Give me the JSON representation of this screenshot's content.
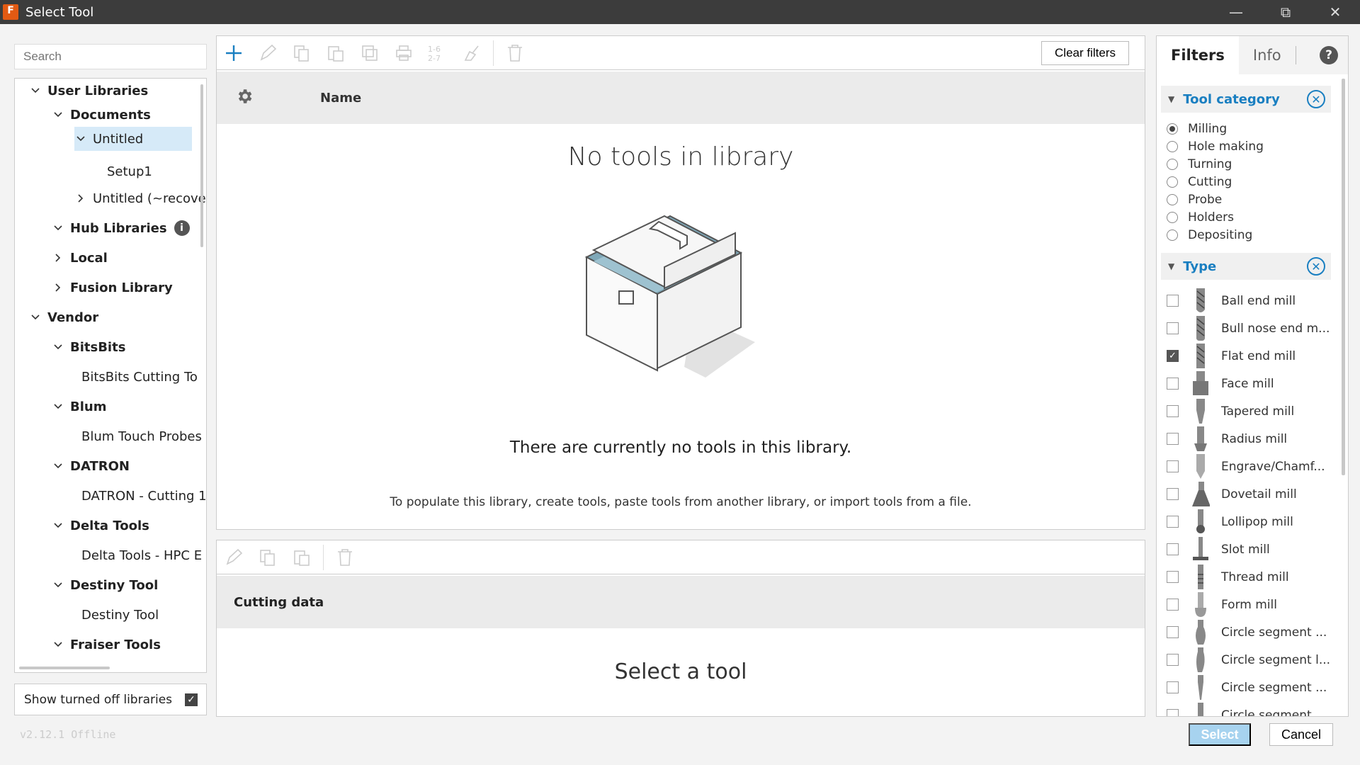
{
  "window": {
    "title": "Select Tool",
    "app_icon_letter": "F"
  },
  "search": {
    "placeholder": "Search"
  },
  "tree": [
    {
      "label": "User Libraries",
      "bold": true
    },
    {
      "label": "Documents",
      "bold": true
    },
    {
      "label": "Untitled",
      "bold": false
    },
    {
      "label": "Setup1",
      "bold": false
    },
    {
      "label": "Untitled (~recove",
      "bold": false
    },
    {
      "label": "Hub Libraries",
      "bold": true
    },
    {
      "label": "Local",
      "bold": true
    },
    {
      "label": "Fusion Library",
      "bold": true
    },
    {
      "label": "Vendor",
      "bold": true
    },
    {
      "label": "BitsBits",
      "bold": true
    },
    {
      "label": "BitsBits Cutting To",
      "bold": false
    },
    {
      "label": "Blum",
      "bold": true
    },
    {
      "label": "Blum Touch Probes",
      "bold": false
    },
    {
      "label": "DATRON",
      "bold": true
    },
    {
      "label": "DATRON - Cutting 1",
      "bold": false
    },
    {
      "label": "Delta Tools",
      "bold": true
    },
    {
      "label": "Delta Tools - HPC E",
      "bold": false
    },
    {
      "label": "Destiny Tool",
      "bold": true
    },
    {
      "label": "Destiny Tool",
      "bold": false
    },
    {
      "label": "Fraiser Tools",
      "bold": true
    }
  ],
  "show_turned_off": {
    "label": "Show turned off libraries",
    "checked": true
  },
  "version": "v2.12.1 Offline",
  "toolbar": {
    "clear_filters": "Clear filters"
  },
  "table": {
    "name_header": "Name"
  },
  "empty": {
    "title": "No tools in library",
    "message": "There are currently no tools in this library.",
    "hint": "To populate this library, create tools, paste tools from another library, or import tools from a file."
  },
  "cutting": {
    "header": "Cutting data",
    "placeholder": "Select a tool"
  },
  "filters": {
    "tabs": [
      "Filters",
      "Info"
    ],
    "tool_category": {
      "label": "Tool category",
      "options": [
        "Milling",
        "Hole making",
        "Turning",
        "Cutting",
        "Probe",
        "Holders",
        "Depositing"
      ],
      "selected": "Milling"
    },
    "type": {
      "label": "Type",
      "options": [
        "Ball end mill",
        "Bull nose end m...",
        "Flat end mill",
        "Face mill",
        "Tapered mill",
        "Radius mill",
        "Engrave/Chamf...",
        "Dovetail mill",
        "Lollipop mill",
        "Slot mill",
        "Thread mill",
        "Form mill",
        "Circle segment ...",
        "Circle segment l...",
        "Circle segment ...",
        "Circle segment"
      ],
      "checked": [
        "Flat end mill"
      ]
    }
  },
  "buttons": {
    "select": "Select",
    "cancel": "Cancel"
  }
}
